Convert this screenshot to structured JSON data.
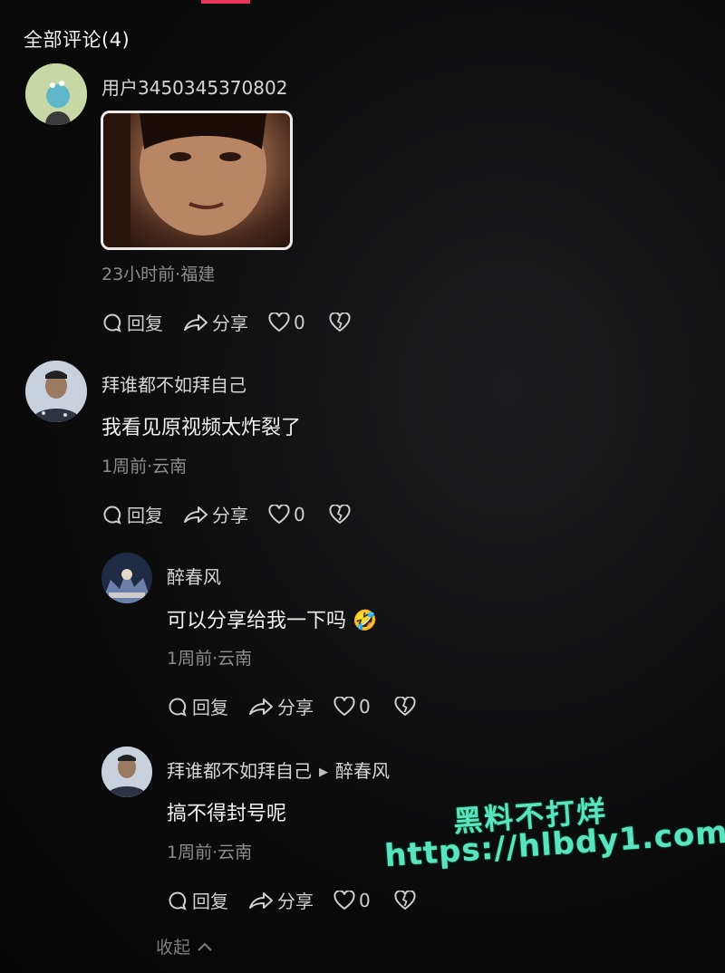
{
  "header": {
    "title": "全部评论(4)"
  },
  "comments": [
    {
      "username": "用户3450345370802",
      "has_image": true,
      "meta": "23小时前·福建",
      "reply_label": "回复",
      "share_label": "分享",
      "like_count": "0"
    },
    {
      "username": "拜谁都不如拜自己",
      "text": "我看见原视频太炸裂了",
      "meta": "1周前·云南",
      "reply_label": "回复",
      "share_label": "分享",
      "like_count": "0"
    }
  ],
  "replies": [
    {
      "username": "醉春风",
      "text": "可以分享给我一下吗",
      "emoji": "🤣",
      "meta": "1周前·云南",
      "reply_label": "回复",
      "share_label": "分享",
      "like_count": "0"
    },
    {
      "username": "拜谁都不如拜自己",
      "reply_to": "醉春风",
      "text": "搞不得封号呢",
      "meta": "1周前·云南",
      "reply_label": "回复",
      "share_label": "分享",
      "like_count": "0"
    }
  ],
  "collapse_label": "收起",
  "watermark": {
    "title": "黑料不打烊",
    "url": "https://hlbdy1.com"
  }
}
